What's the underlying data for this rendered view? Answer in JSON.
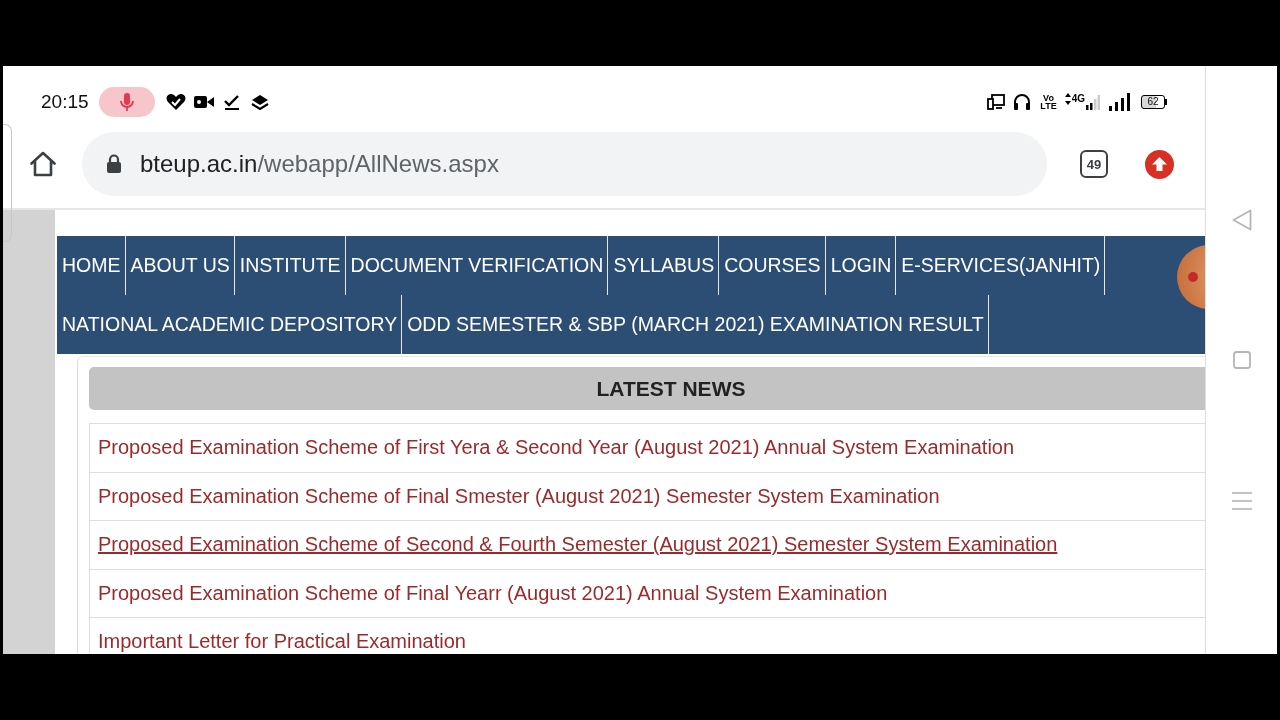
{
  "status_bar": {
    "time": "20:15",
    "volte": "Vo LTE",
    "network_type": "4G",
    "battery": "62"
  },
  "toolbar": {
    "url_host": "bteup.ac.in",
    "url_path": "/webapp/AllNews.aspx",
    "tab_count": "49"
  },
  "nav_menu": [
    "HOME",
    "ABOUT US",
    "INSTITUTE",
    "DOCUMENT VERIFICATION",
    "SYLLABUS",
    "COURSES",
    "LOGIN",
    "E-SERVICES(JANHIT)",
    "NATIONAL ACADEMIC DEPOSITORY",
    "ODD SEMESTER & SBP (MARCH 2021) EXAMINATION RESULT"
  ],
  "latest_news": {
    "title": "LATEST NEWS",
    "items": [
      {
        "text": "Proposed Examination Scheme of First Yera & Second Year (August 2021) Annual System Examination",
        "hovered": false
      },
      {
        "text": "Proposed Examination Scheme of Final Smester (August 2021) Semester System Examination",
        "hovered": false
      },
      {
        "text": "Proposed Examination Scheme of Second & Fourth Semester (August 2021) Semester System Examination",
        "hovered": true
      },
      {
        "text": "Proposed Examination Scheme of Final Yearr (August 2021) Annual System Examination",
        "hovered": false
      },
      {
        "text": "Important Letter for Practical Examination",
        "hovered": false
      }
    ]
  }
}
